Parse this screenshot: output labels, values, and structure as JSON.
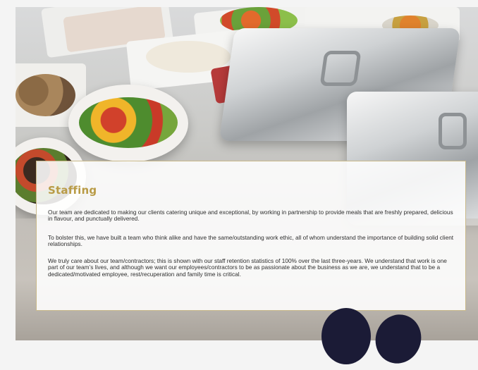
{
  "staffing": {
    "title": "Staffing",
    "paragraphs": [
      "Our team are dedicated to making our clients catering unique and exceptional, by working in partnership to provide meals that are freshly prepared, delicious in flavour, and punctually delivered.",
      "To bolster this, we have built a team who think alike and have the same/outstanding work ethic, all of whom understand the importance of building solid client relationships.",
      "We truly care about our team/contractors; this is shown with our staff retention statistics of 100% over the last three-years. We understand that work is one part of our team’s lives, and although we want our employees/contractors to be as passionate about the business as we are, we understand that to be a dedicated/motivated employee, rest/recuperation and family time is critical."
    ]
  },
  "colors": {
    "title": "#b99b46",
    "card_border": "#c9b98a",
    "decor_dark": "#1b1b36"
  }
}
